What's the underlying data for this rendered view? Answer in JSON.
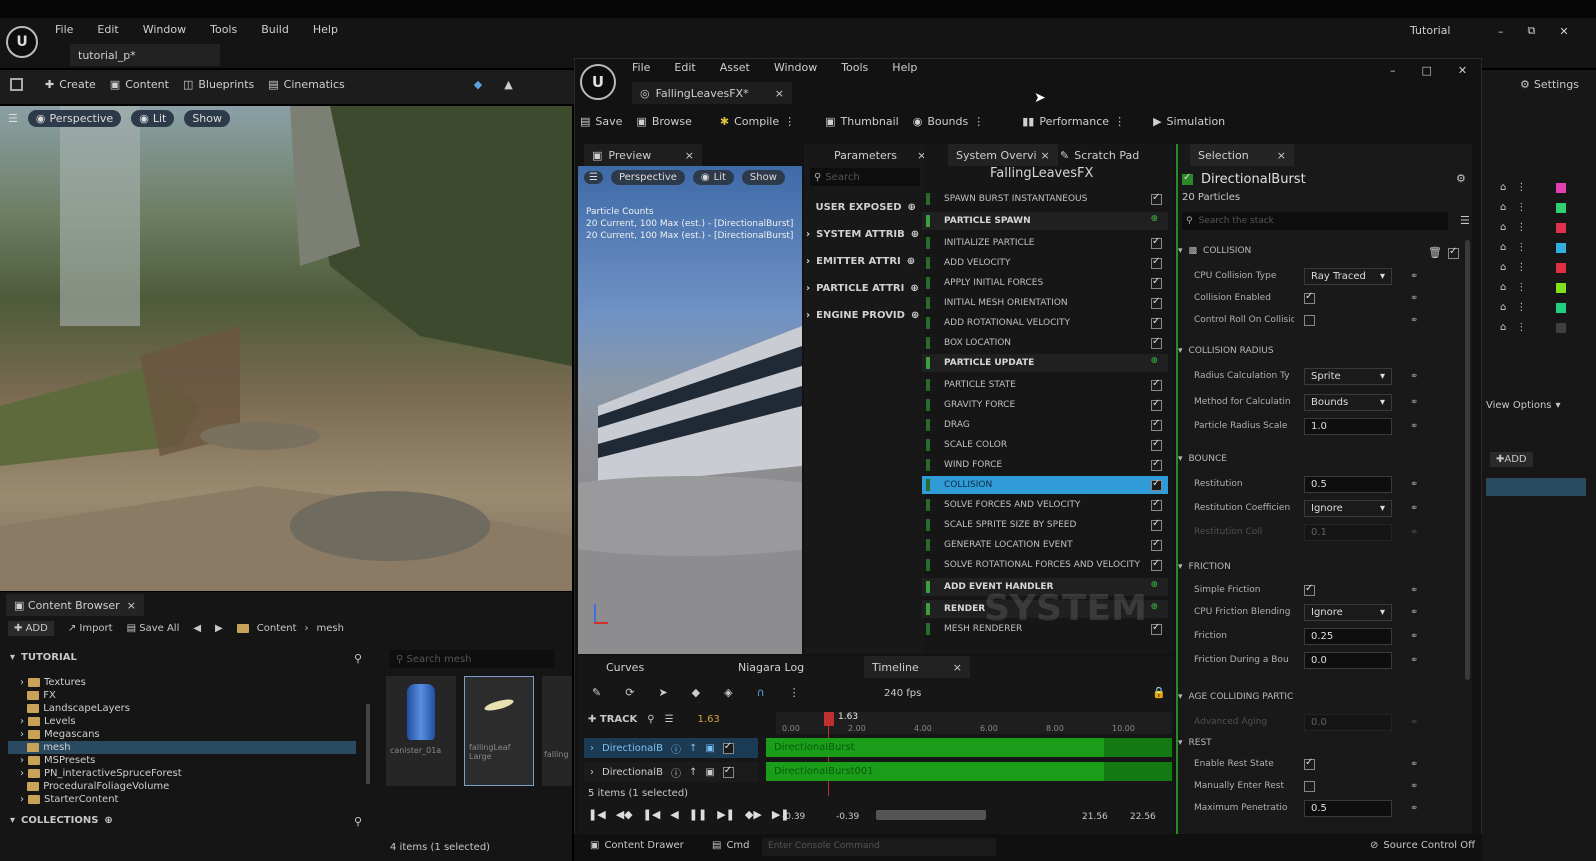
{
  "window": {
    "title": "Tutorial",
    "tab": "tutorial_p*"
  },
  "menu": [
    "File",
    "Edit",
    "Window",
    "Tools",
    "Build",
    "Help"
  ],
  "main_toolbar": {
    "create": "Create",
    "content": "Content",
    "blueprints": "Blueprints",
    "cinematics": "Cinematics",
    "settings": "Settings"
  },
  "viewport": {
    "perspective": "Perspective",
    "lit": "Lit",
    "show": "Show"
  },
  "content_browser": {
    "tab": "Content Browser",
    "add": "ADD",
    "import": "Import",
    "save_all": "Save All",
    "path": [
      "Content",
      "mesh"
    ],
    "tree_root": "TUTORIAL",
    "folders": [
      "Textures",
      "FX",
      "LandscapeLayers",
      "Levels",
      "Megascans",
      "mesh",
      "MSPresets",
      "PN_interactiveSpruceForest",
      "ProceduralFoliageVolume",
      "StarterContent"
    ],
    "collections": "COLLECTIONS",
    "search_placeholder": "Search mesh",
    "assets": [
      "canister_01a",
      "fallingLeaf Large",
      "falling"
    ],
    "status": "4 items (1 selected)",
    "content_drawer": "Content Drawer",
    "cmd": "Cmd",
    "console_placeholder": "Enter Console Command",
    "source_control": "Source Control Off"
  },
  "niagara": {
    "menu": [
      "File",
      "Edit",
      "Asset",
      "Window",
      "Tools",
      "Help"
    ],
    "doc_tab": "FallingLeavesFX*",
    "toolbar": {
      "save": "Save",
      "browse": "Browse",
      "compile": "Compile",
      "thumbnail": "Thumbnail",
      "bounds": "Bounds",
      "performance": "Performance",
      "simulation": "Simulation"
    },
    "preview": {
      "tab": "Preview",
      "perspective": "Perspective",
      "lit": "Lit",
      "show": "Show",
      "counts_title": "Particle Counts",
      "counts": [
        "20 Current, 100 Max (est.) - [DirectionalBurst]",
        "20 Current, 100 Max (est.) - [DirectionalBurst]"
      ]
    },
    "parameters": {
      "tab": "Parameters",
      "search": "Search",
      "groups": [
        "USER EXPOSED",
        "SYSTEM ATTRIB",
        "EMITTER ATTRI",
        "PARTICLE ATTRI",
        "ENGINE PROVID"
      ]
    },
    "system_overview": {
      "tab": "System Overvi",
      "scratch": "Scratch Pad",
      "title": "FallingLeavesFX",
      "rows": [
        {
          "label": "SPAWN BURST INSTANTANEOUS",
          "head": false,
          "sel": false
        },
        {
          "label": "PARTICLE SPAWN",
          "head": true,
          "sel": false
        },
        {
          "label": "INITIALIZE PARTICLE",
          "head": false,
          "sel": false
        },
        {
          "label": "ADD VELOCITY",
          "head": false,
          "sel": false
        },
        {
          "label": "APPLY INITIAL FORCES",
          "head": false,
          "sel": false
        },
        {
          "label": "INITIAL MESH ORIENTATION",
          "head": false,
          "sel": false
        },
        {
          "label": "ADD ROTATIONAL VELOCITY",
          "head": false,
          "sel": false
        },
        {
          "label": "BOX LOCATION",
          "head": false,
          "sel": false
        },
        {
          "label": "PARTICLE UPDATE",
          "head": true,
          "sel": false
        },
        {
          "label": "PARTICLE STATE",
          "head": false,
          "sel": false
        },
        {
          "label": "GRAVITY FORCE",
          "head": false,
          "sel": false
        },
        {
          "label": "DRAG",
          "head": false,
          "sel": false
        },
        {
          "label": "SCALE COLOR",
          "head": false,
          "sel": false
        },
        {
          "label": "WIND FORCE",
          "head": false,
          "sel": false
        },
        {
          "label": "COLLISION",
          "head": false,
          "sel": true
        },
        {
          "label": "SOLVE FORCES AND VELOCITY",
          "head": false,
          "sel": false
        },
        {
          "label": "SCALE SPRITE SIZE BY SPEED",
          "head": false,
          "sel": false
        },
        {
          "label": "GENERATE LOCATION EVENT",
          "head": false,
          "sel": false
        },
        {
          "label": "SOLVE ROTATIONAL FORCES AND VELOCITY",
          "head": false,
          "sel": false
        },
        {
          "label": "ADD EVENT HANDLER",
          "head": true,
          "sel": false
        },
        {
          "label": "RENDER",
          "head": true,
          "sel": false
        },
        {
          "label": "MESH RENDERER",
          "head": false,
          "sel": false
        }
      ],
      "watermark": "SYSTEM"
    },
    "selection": {
      "tab": "Selection",
      "emitter": "DirectionalBurst",
      "particles": "20 Particles",
      "search": "Search the stack",
      "collision": "COLLISION",
      "props": [
        {
          "label": "CPU Collision Type",
          "kind": "select",
          "value": "Ray Traced"
        },
        {
          "label": "Collision Enabled",
          "kind": "check",
          "value": "on"
        },
        {
          "label": "Control Roll On Collision",
          "kind": "check",
          "value": "off"
        }
      ],
      "radius_sec": "COLLISION RADIUS",
      "radius_props": [
        {
          "label": "Radius Calculation Ty",
          "kind": "select",
          "value": "Sprite"
        },
        {
          "label": "Method for Calculatin",
          "kind": "select",
          "value": "Bounds"
        },
        {
          "label": "Particle Radius Scale",
          "kind": "field",
          "value": "1.0"
        }
      ],
      "bounce_sec": "BOUNCE",
      "bounce_props": [
        {
          "label": "Restitution",
          "kind": "field",
          "value": "0.5"
        },
        {
          "label": "Restitution Coefficien",
          "kind": "select",
          "value": "Ignore"
        },
        {
          "label": "Restitution Coll",
          "kind": "field",
          "value": "0.1"
        }
      ],
      "friction_sec": "FRICTION",
      "friction_props": [
        {
          "label": "Simple Friction",
          "kind": "check",
          "value": "on"
        },
        {
          "label": "CPU Friction Blending",
          "kind": "select",
          "value": "Ignore"
        },
        {
          "label": "Friction",
          "kind": "field",
          "value": "0.25"
        },
        {
          "label": "Friction During a Bou",
          "kind": "field",
          "value": "0.0"
        }
      ],
      "age_sec": "AGE COLLIDING PARTIC",
      "age_props": [
        {
          "label": "Advanced Aging",
          "kind": "field",
          "value": "0.0"
        }
      ],
      "rest_sec": "REST",
      "rest_props": [
        {
          "label": "Enable Rest State",
          "kind": "check",
          "value": "on"
        },
        {
          "label": "Manually Enter Rest",
          "kind": "check",
          "value": "off"
        },
        {
          "label": "Maximum Penetratio",
          "kind": "field",
          "value": "0.5"
        }
      ]
    },
    "bottom_tabs": {
      "curves": "Curves",
      "log": "Niagara Log",
      "timeline": "Timeline"
    },
    "timeline": {
      "fps": "240 fps",
      "track": "TRACK",
      "time": "1.63",
      "playhead": "1.63",
      "ticks": [
        "0.00",
        "2.00",
        "4.00",
        "6.00",
        "8.00",
        "10.00"
      ],
      "tracks": [
        "DirectionalB",
        "DirectionalB"
      ],
      "lanes": [
        "DirectionalBurst",
        "DirectionalBurst001"
      ],
      "selected": "5 items (1 selected)",
      "range": [
        "-0.39",
        "-0.39",
        "21.56",
        "22.56"
      ]
    }
  },
  "right_panel": {
    "view_options": "View Options",
    "add": "ADD"
  }
}
